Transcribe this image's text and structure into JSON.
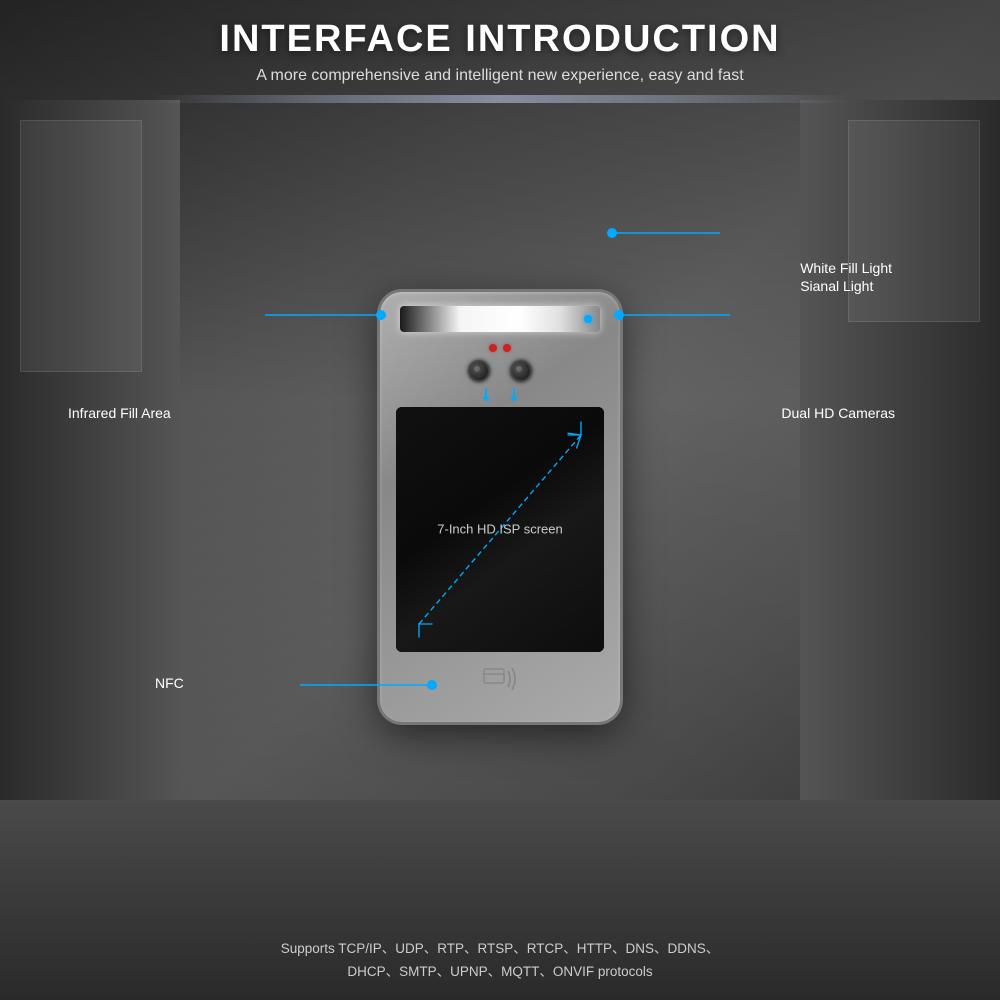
{
  "header": {
    "title": "INTERFACE INTRODUCTION",
    "subtitle": "A more comprehensive and intelligent new experience, easy and fast"
  },
  "annotations": {
    "white_fill_light": "White Fill Light",
    "signal_light": "Sianal Light",
    "infrared_fill_area": "Infrared Fill Area",
    "dual_hd_cameras": "Dual HD Cameras",
    "screen_label": "7-Inch HD ISP screen",
    "nfc": "NFC"
  },
  "protocols": {
    "line1": "Supports TCP/IP、UDP、RTP、RTSP、RTCP、HTTP、DNS、DDNS、",
    "line2": "DHCP、SMTP、UPNP、MQTT、ONVIF protocols"
  },
  "colors": {
    "accent": "#00aaff",
    "text_primary": "#ffffff",
    "text_secondary": "#cccccc",
    "device_bg": "#999999"
  }
}
